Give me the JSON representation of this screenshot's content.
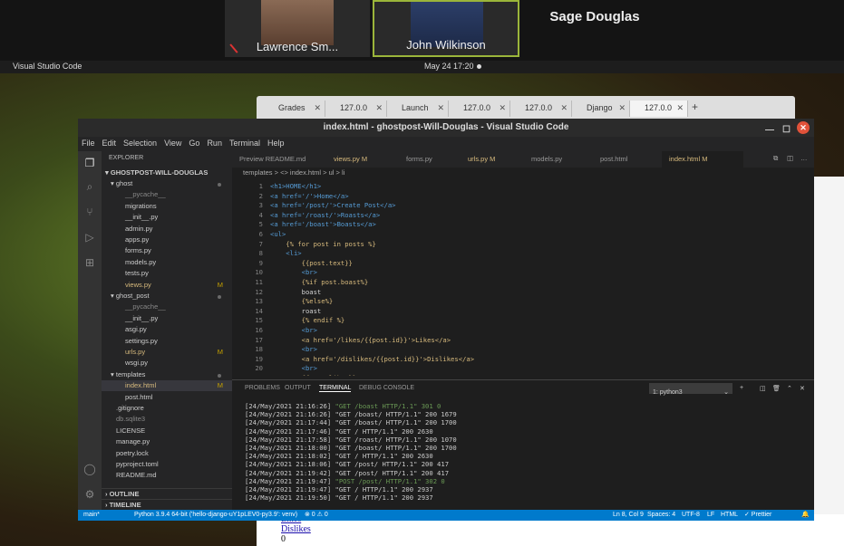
{
  "zoom": {
    "participants": [
      {
        "name": "Lawrence Sm..."
      },
      {
        "name": "John Wilkinson"
      },
      {
        "name": "Sage Douglas"
      }
    ]
  },
  "topbar": {
    "app": "Visual Studio Code",
    "clock": "May 24  17:20"
  },
  "browser": {
    "tabs": [
      "Grades",
      "127.0.0",
      "Launch",
      "127.0.0",
      "127.0.0",
      "Django",
      "127.0.0"
    ]
  },
  "bottompage": {
    "likes": "Likes",
    "dislikes": "Dislikes",
    "zero": "0"
  },
  "vscode": {
    "title": "index.html - ghostpost-Will-Douglas - Visual Studio Code",
    "menu": [
      "File",
      "Edit",
      "Selection",
      "View",
      "Go",
      "Run",
      "Terminal",
      "Help"
    ],
    "explorer_label": "EXPLORER",
    "project": "GHOSTPOST-WILL-DOUGLAS",
    "tree": [
      {
        "label": "ghost",
        "indent": 1,
        "kind": "dir",
        "dot": true
      },
      {
        "label": "__pycache__",
        "indent": 2,
        "kind": "ign"
      },
      {
        "label": "migrations",
        "indent": 2,
        "kind": "plain"
      },
      {
        "label": "__init__.py",
        "indent": 2,
        "kind": "plain"
      },
      {
        "label": "admin.py",
        "indent": 2,
        "kind": "plain"
      },
      {
        "label": "apps.py",
        "indent": 2,
        "kind": "plain"
      },
      {
        "label": "forms.py",
        "indent": 2,
        "kind": "plain"
      },
      {
        "label": "models.py",
        "indent": 2,
        "kind": "plain"
      },
      {
        "label": "tests.py",
        "indent": 2,
        "kind": "plain"
      },
      {
        "label": "views.py",
        "indent": 2,
        "kind": "mod",
        "m": "M"
      },
      {
        "label": "ghost_post",
        "indent": 1,
        "kind": "dir",
        "dot": true
      },
      {
        "label": "__pycache__",
        "indent": 2,
        "kind": "ign"
      },
      {
        "label": "__init__.py",
        "indent": 2,
        "kind": "plain"
      },
      {
        "label": "asgi.py",
        "indent": 2,
        "kind": "plain"
      },
      {
        "label": "settings.py",
        "indent": 2,
        "kind": "plain"
      },
      {
        "label": "urls.py",
        "indent": 2,
        "kind": "mod",
        "m": "M"
      },
      {
        "label": "wsgi.py",
        "indent": 2,
        "kind": "plain"
      },
      {
        "label": "templates",
        "indent": 1,
        "kind": "dir",
        "dot": true
      },
      {
        "label": "index.html",
        "indent": 2,
        "kind": "mod",
        "m": "M",
        "sel": true
      },
      {
        "label": "post.html",
        "indent": 2,
        "kind": "plain"
      },
      {
        "label": ".gitignore",
        "indent": 1,
        "kind": "plain"
      },
      {
        "label": "db.sqlite3",
        "indent": 1,
        "kind": "ign"
      },
      {
        "label": "LICENSE",
        "indent": 1,
        "kind": "plain"
      },
      {
        "label": "manage.py",
        "indent": 1,
        "kind": "plain"
      },
      {
        "label": "poetry.lock",
        "indent": 1,
        "kind": "plain"
      },
      {
        "label": "pyproject.toml",
        "indent": 1,
        "kind": "plain"
      },
      {
        "label": "README.md",
        "indent": 1,
        "kind": "plain"
      }
    ],
    "outline": "OUTLINE",
    "timeline": "TIMELINE",
    "tabs": [
      "Preview README.md",
      "views.py  M",
      "forms.py",
      "urls.py  M",
      "models.py",
      "post.html",
      "index.html  M"
    ],
    "breadcrumb": "templates  >  <> index.html  >  ul  >  li",
    "code": [
      "<h1>HOME</h1>",
      "<a href='/'>Home</a>",
      "<a href='/post/'>Create Post</a>",
      "<a href='/roast/'>Roasts</a>",
      "<a href='/boast'>Boasts</a>",
      "<ul>",
      "    {% for post in posts %}",
      "    <li>",
      "        {{post.text}}",
      "        <br>",
      "        {%if post.boast%}",
      "        boast",
      "        {%else%}",
      "        roast",
      "        {% endif %}",
      "        <br>",
      "        <a href='/likes/{{post.id}}'>Likes</a>",
      "        <br>",
      "        <a href='/dislikes/{{post.id}}'>Dislikes</a>",
      "        <br>",
      "        {{post.likes}}"
    ],
    "panel_tabs": [
      "PROBLEMS",
      "OUTPUT",
      "TERMINAL",
      "DEBUG CONSOLE"
    ],
    "terminal_select": "1: python3",
    "terminal": [
      {
        "t": "[24/May/2021 21:16:26] ",
        "s": "\"GET /boast HTTP/1.1\" 301 0",
        "g": true
      },
      {
        "t": "[24/May/2021 21:16:26] ",
        "s": "\"GET /boast/ HTTP/1.1\" 200 1679",
        "g": false
      },
      {
        "t": "[24/May/2021 21:17:44] ",
        "s": "\"GET /boast/ HTTP/1.1\" 200 1700",
        "g": false
      },
      {
        "t": "[24/May/2021 21:17:46] ",
        "s": "\"GET / HTTP/1.1\" 200 2630",
        "g": false
      },
      {
        "t": "[24/May/2021 21:17:58] ",
        "s": "\"GET /roast/ HTTP/1.1\" 200 1070",
        "g": false
      },
      {
        "t": "[24/May/2021 21:18:00] ",
        "s": "\"GET /boast/ HTTP/1.1\" 200 1700",
        "g": false
      },
      {
        "t": "[24/May/2021 21:18:02] ",
        "s": "\"GET / HTTP/1.1\" 200 2630",
        "g": false
      },
      {
        "t": "[24/May/2021 21:18:06] ",
        "s": "\"GET /post/ HTTP/1.1\" 200 417",
        "g": false
      },
      {
        "t": "[24/May/2021 21:19:42] ",
        "s": "\"GET /post/ HTTP/1.1\" 200 417",
        "g": false
      },
      {
        "t": "[24/May/2021 21:19:47] ",
        "s": "\"POST /post/ HTTP/1.1\" 302 0",
        "g": true
      },
      {
        "t": "[24/May/2021 21:19:47] ",
        "s": "\"GET / HTTP/1.1\" 200 2937",
        "g": false
      },
      {
        "t": "[24/May/2021 21:19:50] ",
        "s": "\"GET / HTTP/1.1\" 200 2937",
        "g": false
      }
    ],
    "status": {
      "branch": "main*",
      "python": "Python 3.9.4 64-bit ('hello-django-uY1pLEV0-py3.9': venv)",
      "problems": "⊗ 0  ⚠ 0",
      "position": "Ln 8, Col 9",
      "spaces": "Spaces: 4",
      "encoding": "UTF-8",
      "eol": "LF",
      "lang": "HTML",
      "prettier": "✓ Prettier"
    }
  }
}
